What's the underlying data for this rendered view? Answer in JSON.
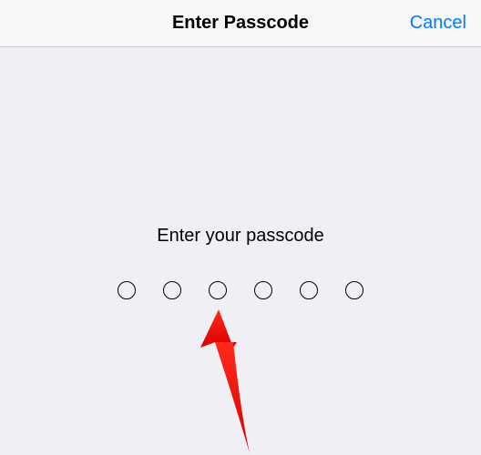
{
  "header": {
    "title": "Enter Passcode",
    "cancel_label": "Cancel"
  },
  "content": {
    "prompt": "Enter your passcode",
    "digit_count": 6,
    "filled_count": 0
  },
  "colors": {
    "accent": "#007aff",
    "arrow": "#ff0000"
  }
}
